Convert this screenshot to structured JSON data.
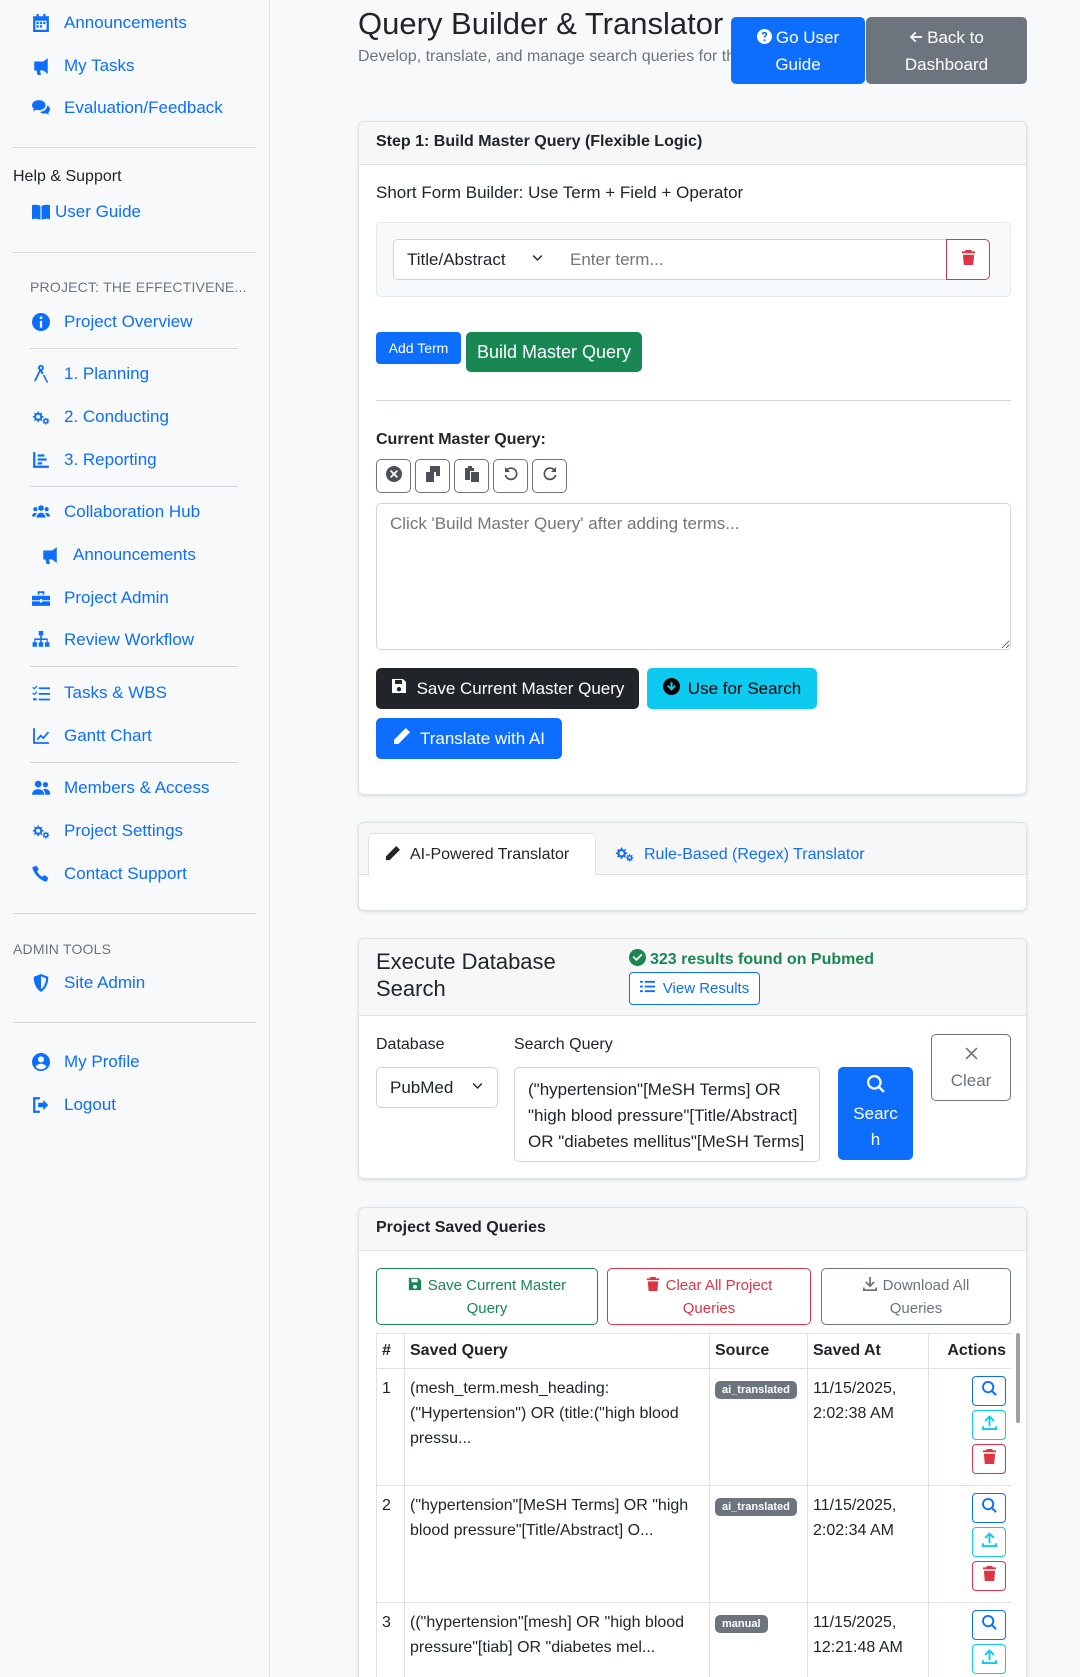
{
  "sidebar": {
    "top_items": [
      {
        "label": "Announcements",
        "icon": "calendar-icon"
      },
      {
        "label": "My Tasks",
        "icon": "megaphone-icon"
      },
      {
        "label": "Evaluation/Feedback",
        "icon": "comments-icon"
      }
    ],
    "help_heading": "Help & Support",
    "user_guide_label": "User Guide",
    "project_heading": "PROJECT: THE EFFECTIVENE...",
    "project_items": [
      {
        "label": "Project Overview",
        "icon": "info-circle-icon"
      },
      {
        "label": "1. Planning",
        "icon": "compass-drafting-icon"
      },
      {
        "label": "2. Conducting",
        "icon": "gears-icon"
      },
      {
        "label": "3. Reporting",
        "icon": "bar-chart-icon"
      },
      {
        "label": "Collaboration Hub",
        "icon": "users-icon"
      },
      {
        "label": "Announcements",
        "icon": "megaphone-icon"
      },
      {
        "label": "Project Admin",
        "icon": "toolbox-icon"
      },
      {
        "label": "Review Workflow",
        "icon": "sitemap-icon"
      },
      {
        "label": "Tasks & WBS",
        "icon": "list-check-icon"
      },
      {
        "label": "Gantt Chart",
        "icon": "line-chart-icon"
      },
      {
        "label": "Members & Access",
        "icon": "user-group-icon"
      },
      {
        "label": "Project Settings",
        "icon": "gears-icon"
      },
      {
        "label": "Contact Support",
        "icon": "phone-icon"
      }
    ],
    "admin_heading": "ADMIN TOOLS",
    "site_admin_label": "Site Admin",
    "profile_label": "My Profile",
    "logout_label": "Logout"
  },
  "header": {
    "title": "Query Builder & Translator",
    "subtitle": "Develop, translate, and manage search queries for this project.",
    "guide_button": "Go User Guide",
    "back_button": "Back to Dashboard"
  },
  "builder": {
    "card_title": "Step 1: Build Master Query (Flexible Logic)",
    "short_form_label": "Short Form Builder: Use Term + Field + Operator",
    "field_select_value": "Title/Abstract",
    "term_placeholder": "Enter term...",
    "add_term_label": "Add Term",
    "build_button_label": "Build Master Query",
    "current_query_label": "Current Master Query:",
    "query_placeholder": "Click 'Build Master Query' after adding terms...",
    "save_button_label": "Save Current Master Query",
    "use_search_label": "Use for Search",
    "translate_label": "Translate with AI"
  },
  "translator_tabs": [
    {
      "label": "AI-Powered Translator",
      "active": true
    },
    {
      "label": "Rule-Based (Regex) Translator",
      "active": false
    }
  ],
  "execute": {
    "title": "Execute Database Search",
    "results_text": "323 results found on Pubmed",
    "view_results_label": "View Results",
    "database_label": "Database",
    "database_value": "PubMed",
    "query_label": "Search Query",
    "query_value": "(\"hypertension\"[MeSH Terms] OR \"high blood pressure\"[Title/Abstract] OR \"diabetes mellitus\"[MeSH Terms] OR",
    "search_button": "Search",
    "clear_button": "Clear"
  },
  "saved": {
    "title": "Project Saved Queries",
    "save_button": "Save Current Master Query",
    "clear_button": "Clear All Project Queries",
    "download_button": "Download All Queries",
    "columns": [
      "#",
      "Saved Query",
      "Source",
      "Saved At",
      "Actions"
    ],
    "rows": [
      {
        "num": "1",
        "query": "(mesh_term.mesh_heading:(\"Hypertension\") OR (title:(\"high blood pressu...",
        "source": "ai_translated",
        "saved_at": "11/15/2025, 2:02:38 AM"
      },
      {
        "num": "2",
        "query": "(\"hypertension\"[MeSH Terms] OR \"high blood pressure\"[Title/Abstract] O...",
        "source": "ai_translated",
        "saved_at": "11/15/2025, 2:02:34 AM"
      },
      {
        "num": "3",
        "query": "((\"hypertension\"[mesh] OR \"high blood pressure\"[tiab] OR \"diabetes mel...",
        "source": "manual",
        "saved_at": "11/15/2025, 12:21:48 AM"
      }
    ]
  },
  "colors": {
    "primary": "#0d6efd",
    "success": "#198754",
    "danger": "#dc3545",
    "info": "#0dcaf0",
    "secondary": "#6c757d",
    "dark": "#212529"
  }
}
